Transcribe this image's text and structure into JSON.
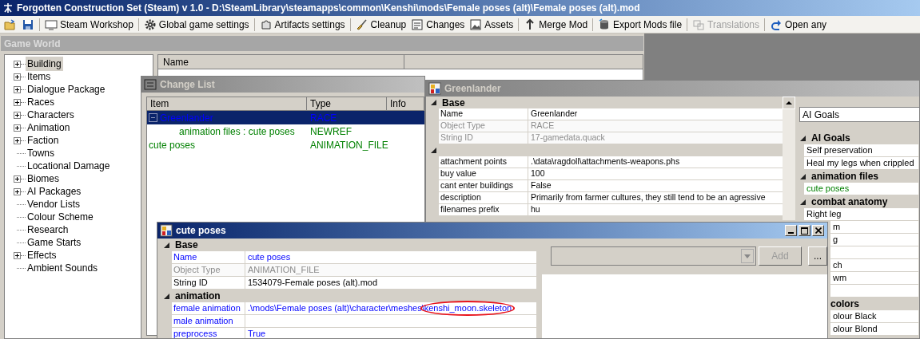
{
  "window": {
    "title": "Forgotten Construction Set (Steam) v 1.0 - D:\\SteamLibrary\\steamapps\\common\\Kenshi\\mods\\Female poses (alt)\\Female poses (alt).mod"
  },
  "toolbar": [
    {
      "items": [
        {
          "kind": "icon",
          "disabled": false
        },
        {
          "kind": "icon",
          "disabled": false
        }
      ]
    },
    {
      "items": [
        {
          "kind": "button",
          "label": "Steam Workshop",
          "disabled": false
        }
      ]
    },
    {
      "items": [
        {
          "kind": "button",
          "label": "Global game settings",
          "disabled": false
        }
      ]
    },
    {
      "items": [
        {
          "kind": "button",
          "label": "Artifacts settings",
          "disabled": false
        }
      ]
    },
    {
      "items": [
        {
          "kind": "button",
          "label": "Cleanup",
          "disabled": false
        },
        {
          "kind": "button",
          "label": "Changes",
          "disabled": false
        },
        {
          "kind": "button",
          "label": "Assets",
          "disabled": false
        }
      ]
    },
    {
      "items": [
        {
          "kind": "button",
          "label": "Merge Mod",
          "disabled": false
        }
      ]
    },
    {
      "items": [
        {
          "kind": "button",
          "label": "Export Mods file",
          "disabled": false
        }
      ]
    },
    {
      "items": [
        {
          "kind": "button",
          "label": "Translations",
          "disabled": true
        }
      ]
    },
    {
      "items": [
        {
          "kind": "button",
          "label": "Open any",
          "disabled": false
        }
      ]
    }
  ],
  "game_world": {
    "title": "Game World",
    "tree": [
      {
        "label": "Building",
        "expandable": true,
        "selected": true
      },
      {
        "label": "Items",
        "expandable": true,
        "selected": false
      },
      {
        "label": "Dialogue Package",
        "expandable": true,
        "selected": false
      },
      {
        "label": "Races",
        "expandable": true,
        "selected": false
      },
      {
        "label": "Characters",
        "expandable": true,
        "selected": false
      },
      {
        "label": "Animation",
        "expandable": true,
        "selected": false
      },
      {
        "label": "Faction",
        "expandable": true,
        "selected": false
      },
      {
        "label": "Towns",
        "expandable": false,
        "selected": false
      },
      {
        "label": "Locational Damage",
        "expandable": false,
        "selected": false
      },
      {
        "label": "Biomes",
        "expandable": true,
        "selected": false
      },
      {
        "label": "AI Packages",
        "expandable": true,
        "selected": false
      },
      {
        "label": "Vendor Lists",
        "expandable": false,
        "selected": false
      },
      {
        "label": "Colour Scheme",
        "expandable": false,
        "selected": false
      },
      {
        "label": "Research",
        "expandable": false,
        "selected": false
      },
      {
        "label": "Game Starts",
        "expandable": false,
        "selected": false
      },
      {
        "label": "Effects",
        "expandable": true,
        "selected": false
      },
      {
        "label": "Ambient Sounds",
        "expandable": false,
        "selected": false
      }
    ],
    "list": {
      "columns": [
        "Name"
      ]
    }
  },
  "change_list": {
    "title": "Change List",
    "active": false,
    "columns": [
      "Item",
      "Type",
      "Info"
    ],
    "rows": [
      {
        "item": "Greenlander",
        "type": "RACE",
        "selected": true,
        "expanded": true,
        "kind": "changed",
        "children": [
          {
            "item": "animation files : cute poses",
            "type": "NEWREF",
            "selected": false,
            "kind": "new"
          }
        ]
      },
      {
        "item": "cute poses",
        "type": "ANIMATION_FILE",
        "selected": false,
        "kind": "new"
      }
    ]
  },
  "greenlander": {
    "title": "Greenlander",
    "active": false,
    "sections": [
      {
        "title": "Base",
        "rows": [
          {
            "name": "Name",
            "value": "Greenlander",
            "kind": "plain"
          },
          {
            "name": "Object Type",
            "value": "RACE",
            "kind": "readonly"
          },
          {
            "name": "String ID",
            "value": "17-gamedata.quack",
            "kind": "readonly"
          }
        ]
      },
      {
        "rows": [
          {
            "name": "attachment points",
            "value": ".\\data\\ragdoll\\attachments-weapons.phs",
            "kind": "plain"
          },
          {
            "name": "buy value",
            "value": "100",
            "kind": "plain"
          },
          {
            "name": "cant enter buildings",
            "value": "False",
            "kind": "plain"
          },
          {
            "name": "description",
            "value": "Primarily from farmer cultures, they still tend to be an agressive",
            "kind": "plain"
          },
          {
            "name": "filenames prefix",
            "value": "hu",
            "kind": "plain"
          }
        ]
      }
    ],
    "side": {
      "selector": "AI Goals",
      "sections": [
        {
          "title": "AI Goals",
          "kind": "plain",
          "items": [
            {
              "label": "Self preservation",
              "kind": "plain"
            },
            {
              "label": "Heal my legs when crippled",
              "kind": "plain"
            }
          ]
        },
        {
          "title": "animation files",
          "kind": "plain",
          "items": [
            {
              "label": "cute poses",
              "kind": "new"
            }
          ]
        },
        {
          "title": "combat anatomy",
          "kind": "plain",
          "items": [
            {
              "label": "Right leg",
              "kind": "plain"
            },
            {
              "label": "m",
              "kind": "clipped"
            },
            {
              "label": "g",
              "kind": "clipped"
            },
            {
              "kind": "blank"
            },
            {
              "label": "ch",
              "kind": "clipped"
            },
            {
              "label": "wm",
              "kind": "clipped"
            },
            {
              "kind": "blank"
            }
          ]
        },
        {
          "title": "colors",
          "kind": "clipped",
          "items": [
            {
              "label": "olour Black",
              "kind": "clipped"
            },
            {
              "label": "olour Blond",
              "kind": "clipped"
            }
          ]
        }
      ]
    }
  },
  "cute_poses": {
    "title": "cute poses",
    "active": true,
    "sections": [
      {
        "title": "Base",
        "rows": [
          {
            "name": "Name",
            "value": "cute poses",
            "kind": "changed"
          },
          {
            "name": "Object Type",
            "value": "ANIMATION_FILE",
            "kind": "readonly"
          },
          {
            "name": "String ID",
            "value": "1534079-Female poses (alt).mod",
            "kind": "plain"
          }
        ]
      },
      {
        "title": "animation",
        "rows": [
          {
            "name": "female animation",
            "value": ".\\mods\\Female poses (alt)\\character\\meshes",
            "circled_value": "\\kenshi_moon.skeleton",
            "kind": "changed"
          },
          {
            "name": "male animation",
            "kind": "changed"
          },
          {
            "name": "preprocess",
            "value": "True",
            "kind": "changed"
          }
        ]
      }
    ],
    "side": {
      "selector": {
        "disabled": true
      },
      "add_button": {
        "label": "Add",
        "disabled": true
      },
      "browse_button": {
        "label": "...",
        "disabled": false
      }
    }
  }
}
